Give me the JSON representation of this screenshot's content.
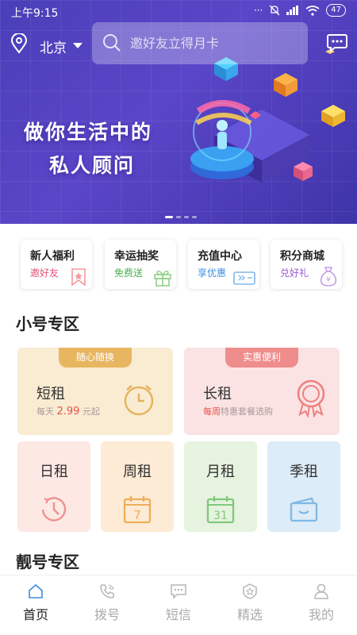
{
  "status_bar": {
    "time": "上午9:15",
    "battery": "47",
    "signal_dots": "···"
  },
  "header": {
    "city": "北京",
    "search_placeholder": "邀好友立得月卡"
  },
  "banner": {
    "slogan_line1": "做你生活中的",
    "slogan_line2": "私人顾问",
    "slide_count": 4,
    "active_slide": 0
  },
  "quick_entries": [
    {
      "title": "新人福利",
      "subtitle": "邀好友",
      "subtitle_color": "#e8517a",
      "icon": "bookmark-star-icon"
    },
    {
      "title": "幸运抽奖",
      "subtitle": "免费送",
      "subtitle_color": "#4ab34f",
      "icon": "gift-icon"
    },
    {
      "title": "充值中心",
      "subtitle": "享优惠",
      "subtitle_color": "#3a8de0",
      "icon": "recharge-card-icon"
    },
    {
      "title": "积分商城",
      "subtitle": "兑好礼",
      "subtitle_color": "#9b59d0",
      "icon": "points-bag-icon"
    }
  ],
  "section_small": {
    "title": "小号专区"
  },
  "short_rent": {
    "tag": "随心随换",
    "title": "短租",
    "sub_prefix": "每天 ",
    "sub_price": "2.99",
    "sub_suffix": " 元起",
    "icon": "alarm-clock-icon"
  },
  "long_rent": {
    "tag": "实惠便利",
    "title": "长租",
    "sub_highlight": "每周",
    "sub_rest": "特惠套餐选购",
    "icon": "award-medal-icon"
  },
  "rent_types": [
    {
      "title": "日租",
      "icon": "clock-icon",
      "icon_text": ""
    },
    {
      "title": "周租",
      "icon": "calendar-7-icon",
      "icon_text": "7"
    },
    {
      "title": "月租",
      "icon": "calendar-31-icon",
      "icon_text": "31"
    },
    {
      "title": "季租",
      "icon": "wallet-icon",
      "icon_text": ""
    }
  ],
  "section_fancy": {
    "title": "靓号专区"
  },
  "tabs": [
    {
      "label": "首页",
      "icon": "home-icon",
      "active": true
    },
    {
      "label": "拨号",
      "icon": "phone-icon",
      "active": false
    },
    {
      "label": "短信",
      "icon": "message-icon",
      "active": false
    },
    {
      "label": "精选",
      "icon": "star-shield-icon",
      "active": false
    },
    {
      "label": "我的",
      "icon": "user-icon",
      "active": false
    }
  ],
  "colors": {
    "banner": "#5244c0",
    "accent_red": "#e8514a",
    "tab_active": "#3a8de0",
    "tab_inactive": "#aaaaaa"
  }
}
